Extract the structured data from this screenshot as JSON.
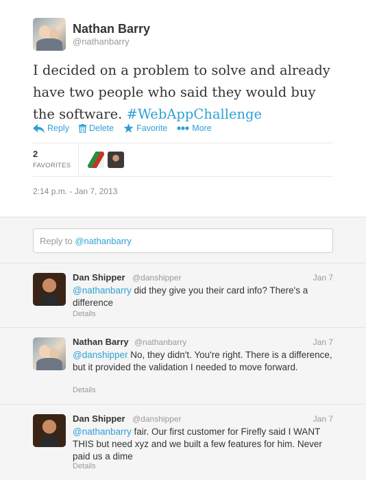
{
  "tweet": {
    "author_name": "Nathan Barry",
    "author_handle": "@nathanbarry",
    "text": "I decided on a problem to solve and already have two people who said they would buy the software.",
    "hashtag": "#WebAppChallenge",
    "actions": {
      "reply": "Reply",
      "delete": "Delete",
      "favorite": "Favorite",
      "more": "More"
    },
    "favorites_count": "2",
    "favorites_label": "FAVORITES",
    "timestamp": "2:14 p.m. - Jan 7, 2013",
    "icons": [
      "reply-icon",
      "trash-icon",
      "star-icon",
      "more-dots-icon"
    ],
    "accent_color": "#2ea1d6"
  },
  "reply_box": {
    "prefix": "Reply to ",
    "mention": "@nathanbarry"
  },
  "replies": [
    {
      "name": "Dan Shipper",
      "handle": "@danshipper",
      "date": "Jan 7",
      "mention": "@nathanbarry",
      "text": " did they give you their card info? There's a difference",
      "details": "Details"
    },
    {
      "name": "Nathan Barry",
      "handle": "@nathanbarry",
      "date": "Jan 7",
      "mention": "@danshipper",
      "text": " No, they didn't. You're right. There is a difference, but it provided the validation I needed to move forward.",
      "details": "Details"
    },
    {
      "name": "Dan Shipper",
      "handle": "@danshipper",
      "date": "Jan 7",
      "mention": "@nathanbarry",
      "text": " fair. Our first customer for Firefly said I WANT THIS but need xyz and we built a few features for him. Never paid us a dime",
      "details": "Details"
    }
  ]
}
